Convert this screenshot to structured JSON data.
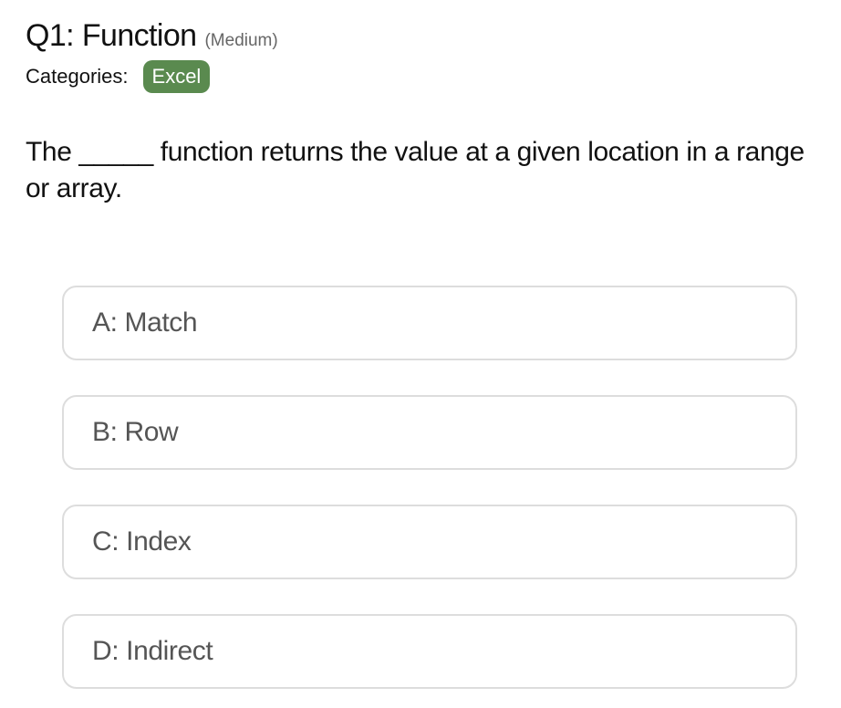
{
  "question": {
    "title": "Q1: Function",
    "difficulty": "(Medium)",
    "categories_label": "Categories:",
    "categories": [
      "Excel"
    ],
    "text": "The _____ function returns the value at a given location in a range or array."
  },
  "options": [
    {
      "label": "A: Match"
    },
    {
      "label": "B: Row"
    },
    {
      "label": "C: Index"
    },
    {
      "label": "D: Indirect"
    }
  ],
  "colors": {
    "badge_bg": "#5a8a4f",
    "option_border": "#dddddd",
    "option_text": "#555555"
  }
}
